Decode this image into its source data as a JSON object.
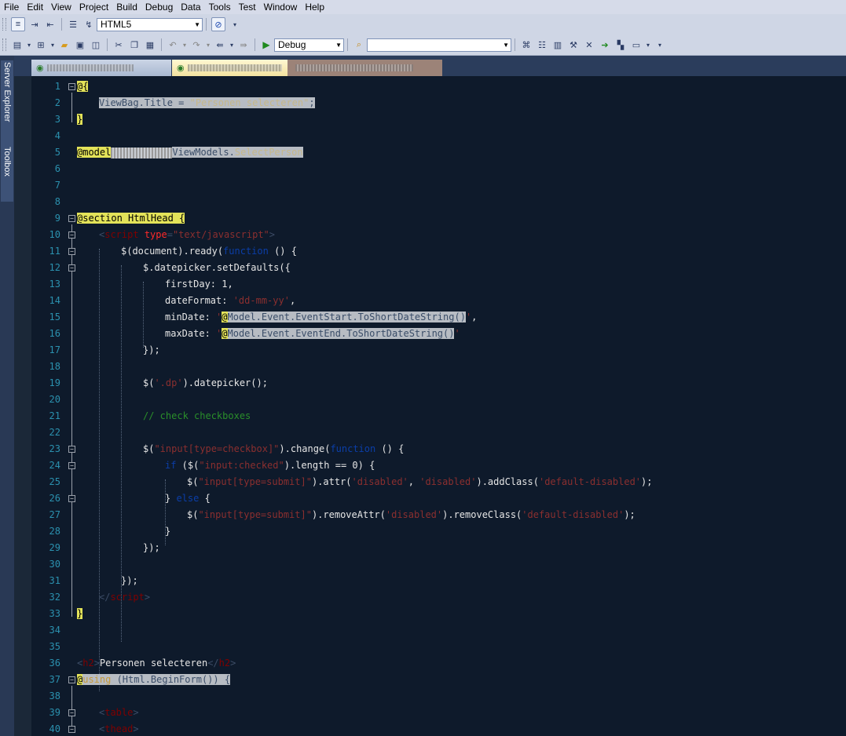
{
  "menu": [
    "File",
    "Edit",
    "View",
    "Project",
    "Build",
    "Debug",
    "Data",
    "Tools",
    "Test",
    "Window",
    "Help"
  ],
  "toolbar": {
    "schema_value": "HTML5",
    "config_value": "Debug",
    "find_value": ""
  },
  "side_tabs": [
    "Server Explorer",
    "Toolbox"
  ],
  "editor": {
    "lines": [
      {
        "n": "1"
      },
      {
        "n": "2"
      },
      {
        "n": "3"
      },
      {
        "n": "4"
      },
      {
        "n": "5"
      },
      {
        "n": "6"
      },
      {
        "n": "7"
      },
      {
        "n": "8"
      },
      {
        "n": "9"
      },
      {
        "n": "10"
      },
      {
        "n": "11"
      },
      {
        "n": "12"
      },
      {
        "n": "13"
      },
      {
        "n": "14"
      },
      {
        "n": "15"
      },
      {
        "n": "16"
      },
      {
        "n": "17"
      },
      {
        "n": "18"
      },
      {
        "n": "19"
      },
      {
        "n": "20"
      },
      {
        "n": "21"
      },
      {
        "n": "22"
      },
      {
        "n": "23"
      },
      {
        "n": "24"
      },
      {
        "n": "25"
      },
      {
        "n": "26"
      },
      {
        "n": "27"
      },
      {
        "n": "28"
      },
      {
        "n": "29"
      },
      {
        "n": "30"
      },
      {
        "n": "31"
      },
      {
        "n": "32"
      },
      {
        "n": "33"
      },
      {
        "n": "34"
      },
      {
        "n": "35"
      },
      {
        "n": "36"
      },
      {
        "n": "37"
      },
      {
        "n": "38"
      },
      {
        "n": "39"
      },
      {
        "n": "40"
      }
    ],
    "code": {
      "l1_at": "@{",
      "l2_a": "ViewBag.Title = ",
      "l2_b": "\"Personen selecteren\"",
      "l2_c": ";",
      "l3": "}",
      "l5_a": "@model",
      "l5_b": "ViewModels.",
      "l5_c": "SelectPerson",
      "l9_a": "@section HtmlHead {",
      "l10_a": "<",
      "l10_b": "script",
      "l10_c": " type",
      "l10_d": "=",
      "l10_e": "\"text/javascript\"",
      "l10_f": ">",
      "l11_a": "$(document).ready(",
      "l11_b": "function",
      "l11_c": " () {",
      "l12": "$.datepicker.setDefaults({",
      "l13": "firstDay: 1,",
      "l14_a": "dateFormat: ",
      "l14_b": "'dd-mm-yy'",
      "l14_c": ",",
      "l15_a": "minDate: ",
      "l15_b": "'",
      "l15_c": "@",
      "l15_d": "Model.Event.EventStart.ToShortDateString()",
      "l15_e": "'",
      "l15_f": ",",
      "l16_a": "maxDate: ",
      "l16_b": "'",
      "l16_c": "@",
      "l16_d": "Model.Event.EventEnd.ToShortDateString()",
      "l16_e": "'",
      "l17": "});",
      "l19_a": "$(",
      "l19_b": "'.dp'",
      "l19_c": ").datepicker();",
      "l21": "// check checkboxes",
      "l23_a": "$(",
      "l23_b": "\"input[type=checkbox]\"",
      "l23_c": ").change(",
      "l23_d": "function",
      "l23_e": " () {",
      "l24_a": "if",
      "l24_b": " ($(",
      "l24_c": "\"input:checked\"",
      "l24_d": ").length == 0) {",
      "l25_a": "$(",
      "l25_b": "\"input[type=submit]\"",
      "l25_c": ").attr(",
      "l25_d": "'disabled'",
      "l25_e": ", ",
      "l25_f": "'disabled'",
      "l25_g": ").addClass(",
      "l25_h": "'default-disabled'",
      "l25_i": ");",
      "l26_a": "} ",
      "l26_b": "else",
      "l26_c": " {",
      "l27_a": "$(",
      "l27_b": "\"input[type=submit]\"",
      "l27_c": ").removeAttr(",
      "l27_d": "'disabled'",
      "l27_e": ").removeClass(",
      "l27_f": "'default-disabled'",
      "l27_g": ");",
      "l28": "}",
      "l29": "});",
      "l31": "});",
      "l32_a": "</",
      "l32_b": "script",
      "l32_c": ">",
      "l33": "}",
      "l36_a": "<",
      "l36_b": "h2",
      "l36_c": ">",
      "l36_d": "Personen selecteren",
      "l36_e": "</",
      "l36_f": "h2",
      "l36_g": ">",
      "l37_a": "@",
      "l37_b": "using",
      "l37_c": " (Html.BeginForm()) {",
      "l39_a": "<",
      "l39_b": "table",
      "l39_c": ">",
      "l40_a": "<",
      "l40_b": "thead",
      "l40_c": ">"
    }
  }
}
